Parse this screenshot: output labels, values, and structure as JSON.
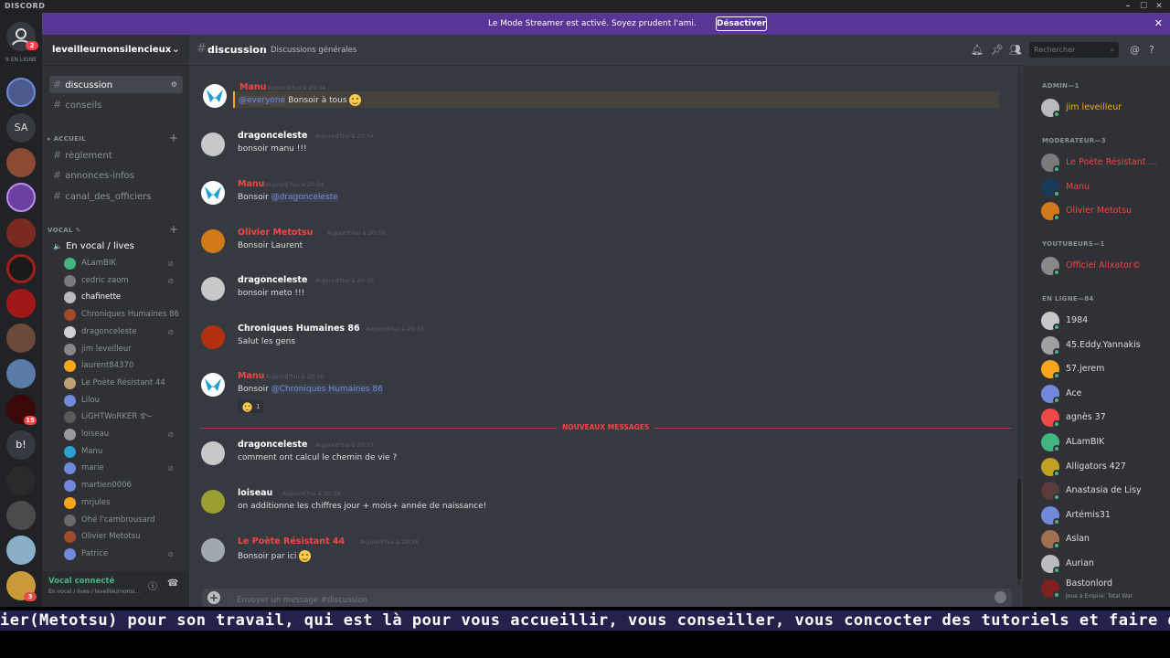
{
  "window": {
    "title": "DISCORD",
    "min": "–",
    "max": "☐",
    "close": "✕"
  },
  "banner": {
    "message": "Le Mode Streamer est activé. Soyez prudent l'ami.",
    "button": "Désactiver",
    "close": "✕"
  },
  "rail": {
    "online_count": "9 EN LIGNE",
    "home_badge": "2",
    "sa": "SA",
    "b": "b!",
    "badges": [
      "15",
      "3"
    ]
  },
  "guild": {
    "name": "leveilleurnonsilencieux"
  },
  "channels": {
    "top": [
      {
        "name": "discussion",
        "active": true
      },
      {
        "name": "conseils"
      }
    ],
    "accueil_label": "ACCUEIL",
    "accueil": [
      "règlement",
      "annonces-infos",
      "canal_des_officiers"
    ],
    "vocal_label": "VOCAL",
    "voice_channel": "En vocal / lives",
    "voice_users": [
      "ALamBIK",
      "cedric zaom",
      "chafinette",
      "Chroniques Humaines 86",
      "dragonceleste",
      "jim leveilleur",
      "laurent84370",
      "Le Poète Résistant 44",
      "Lilou",
      "LiGHTWoRKER ࿐",
      "loiseau",
      "Manu",
      "marie",
      "martien0006",
      "mrjules",
      "Ohé l'cambrousard",
      "Olivier Metotsu",
      "Patrice"
    ],
    "voice_connected": "Vocal connecté",
    "voice_connected_sub": "En vocal / lives / leveilleurnonsi..."
  },
  "header": {
    "channel": "discussion",
    "topic": "Discussions générales",
    "search_placeholder": "Rechercher"
  },
  "messages": [
    {
      "author": "Manu",
      "color": "#f04747",
      "time": "Aujourd'hui à 20:34",
      "mention": "@everyone",
      "text": "Bonsoir à tous",
      "emoji": true
    },
    {
      "author": "dragonceleste",
      "color": "#ffffff",
      "time": "Aujourd'hui à 20:34",
      "text": "bonsoir manu !!!"
    },
    {
      "author": "Manu",
      "color": "#f04747",
      "time": "Aujourd'hui à 20:34",
      "text": "Bonsoir",
      "mention": "@dragonceleste"
    },
    {
      "author": "Olivier Metotsu",
      "color": "#f04747",
      "time": "Aujourd'hui à 20:35",
      "text": "Bonsoir Laurent"
    },
    {
      "author": "dragonceleste",
      "color": "#ffffff",
      "time": "Aujourd'hui à 20:35",
      "text": "bonsoir meto !!!"
    },
    {
      "author": "Chroniques Humaines 86",
      "color": "#ffffff",
      "time": "Aujourd'hui à 20:36",
      "text": "Salut les gens"
    },
    {
      "author": "Manu",
      "color": "#f04747",
      "time": "Aujourd'hui à 20:36",
      "text": "Bonsoir",
      "mention": "@Chroniques Humaines 86",
      "reaction": "1"
    },
    {
      "author": "dragonceleste",
      "color": "#ffffff",
      "time": "Aujourd'hui à 20:37",
      "text": "comment ont calcul le chemin de vie ?"
    },
    {
      "author": "loiseau",
      "color": "#ffffff",
      "time": "Aujourd'hui à 20:38",
      "text": "on additionne les chiffres jour + mois+ année de naissance!"
    },
    {
      "author": "Le Poète Résistant 44",
      "color": "#f04747",
      "time": "Aujourd'hui à 20:38",
      "text": "Bonsoir par ici",
      "emoji": true
    }
  ],
  "new_messages_label": "NOUVEAUX MESSAGES",
  "composer": {
    "placeholder": "Envoyer un message #discussion"
  },
  "members": {
    "admin_label": "ADMIN—1",
    "admin": [
      {
        "name": "jim leveilleur",
        "color": "#faa61a"
      }
    ],
    "mod_label": "MODERATEUR—3",
    "mods": [
      {
        "name": "Le Poète Résistant ...",
        "color": "#f04747"
      },
      {
        "name": "Manu",
        "color": "#f04747"
      },
      {
        "name": "Olivier Metotsu",
        "color": "#f04747"
      }
    ],
    "yt_label": "YOUTUBEURS—1",
    "yt": [
      {
        "name": "Officiel Alixator©",
        "color": "#f04747"
      }
    ],
    "online_label": "EN LIGNE—84",
    "online": [
      {
        "name": "1984"
      },
      {
        "name": "45.Eddy.Yannakis"
      },
      {
        "name": "57.jerem"
      },
      {
        "name": "Ace"
      },
      {
        "name": "agnès 37"
      },
      {
        "name": "ALamBIK"
      },
      {
        "name": "Alligators 427"
      },
      {
        "name": "Anastasia de Lisy"
      },
      {
        "name": "Artémis31"
      },
      {
        "name": "Aslan"
      },
      {
        "name": "Aurian"
      },
      {
        "name": "Bastonlord",
        "sub": "Joue à Empire: Total War"
      }
    ]
  },
  "subtitle": "ier(Metotsu) pour son travail, qui est là pour vous accueillir, vous conseiller, vous concocter des tutoriels et faire d"
}
